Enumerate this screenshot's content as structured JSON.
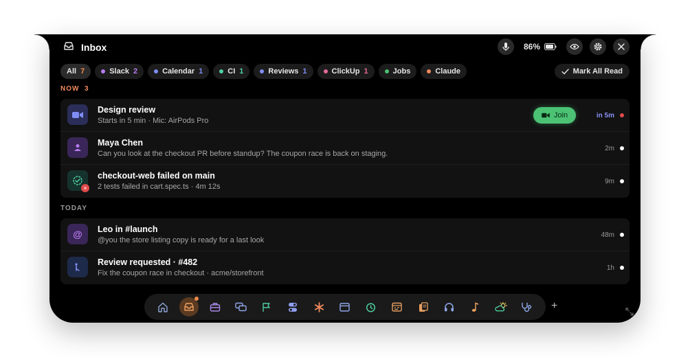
{
  "header": {
    "title": "Inbox",
    "battery": "86%"
  },
  "filters": [
    {
      "label": "All",
      "count": "7",
      "color": ""
    },
    {
      "label": "Slack",
      "count": "2",
      "color": "#b77cf0"
    },
    {
      "label": "Calendar",
      "count": "1",
      "color": "#7f8ef5"
    },
    {
      "label": "CI",
      "count": "1",
      "color": "#4fd0a0"
    },
    {
      "label": "Reviews",
      "count": "1",
      "color": "#7f8ef5"
    },
    {
      "label": "ClickUp",
      "count": "1",
      "color": "#e46a9a"
    },
    {
      "label": "Jobs",
      "count": "",
      "color": "#4bc274"
    },
    {
      "label": "Claude",
      "count": "",
      "color": "#f08a5d"
    }
  ],
  "mark_all_read": "Mark All Read",
  "sections": {
    "now": {
      "label": "NOW",
      "count": "3"
    },
    "today": {
      "label": "TODAY"
    }
  },
  "now_items": [
    {
      "title": "Design review",
      "subtitle": "Starts in 5 min · Mic: AirPods Pro",
      "time": "in 5m",
      "join": "Join"
    },
    {
      "title": "Maya Chen",
      "subtitle": "Can you look at the checkout PR before standup? The coupon race is back on staging.",
      "time": "2m"
    },
    {
      "title": "checkout-web failed on main",
      "subtitle": "2 tests failed in cart.spec.ts · 4m 12s",
      "time": "9m"
    }
  ],
  "today_items": [
    {
      "title": "Leo in #launch",
      "subtitle": "@you the store listing copy is ready for a last look",
      "time": "48m",
      "icon_glyph": "@"
    },
    {
      "title": "Review requested · #482",
      "subtitle": "Fix the coupon race in checkout · acme/storefront",
      "time": "1h"
    }
  ],
  "dock": {
    "add": "+"
  },
  "colors": {
    "accent_orange": "#f08a4a",
    "now_label": "#f08a5d",
    "today_label": "#9a9a9a",
    "join_green": "#4bc274",
    "unread_red": "#e14a4a",
    "time_accent": "#8a8ff5"
  }
}
